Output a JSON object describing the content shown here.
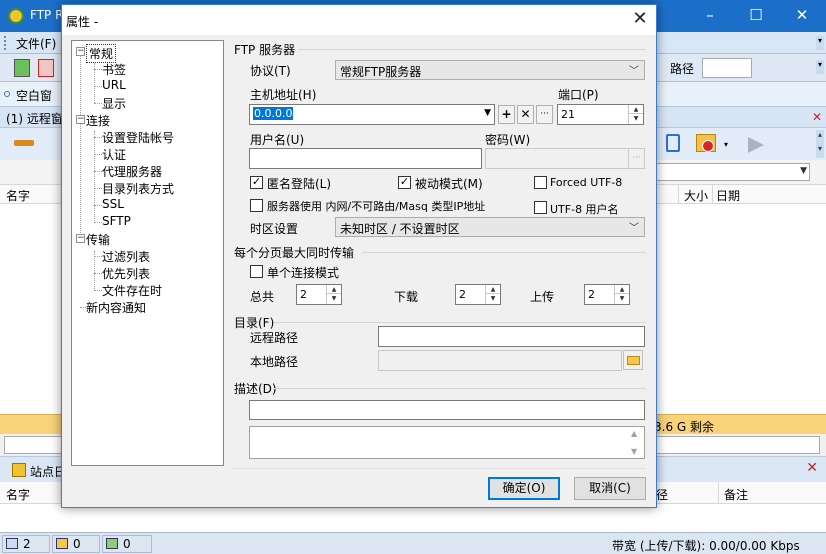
{
  "background": {
    "app_title": "FTP R",
    "menu": {
      "file": "文件(F)"
    },
    "toolbar": {
      "path_label": "路径"
    },
    "site_bar": {
      "label": "空白窗"
    },
    "remote_header": "(1) 远程窗",
    "columns": {
      "name": "名字",
      "size": "大小",
      "date": "日期"
    },
    "free_space": "3.6 G 剩余",
    "site_tab": "站点日",
    "bottom_columns": {
      "name": "名字",
      "path": "径",
      "note": "备注"
    },
    "status": {
      "count1": "2",
      "count2": "0",
      "count3": "0",
      "bandwidth": "带宽 (上传/下载): 0.00/0.00 Kbps"
    }
  },
  "dialog": {
    "title": "属性 -",
    "close_glyph": "✕",
    "tree": {
      "general": "常规",
      "bookmarks": "书签",
      "url": "URL",
      "display": "显示",
      "connection": "连接",
      "login_accounts": "设置登陆帐号",
      "auth": "认证",
      "proxy": "代理服务器",
      "list_method": "目录列表方式",
      "ssl": "SSL",
      "sftp": "SFTP",
      "transfer": "传输",
      "filter_list": "过滤列表",
      "priority_list": "优先列表",
      "file_exists": "文件存在时",
      "new_content": "新内容通知"
    },
    "ftp_server": {
      "section": "FTP 服务器",
      "protocol_label": "协议(T)",
      "protocol_value": "常规FTP服务器",
      "host_label": "主机地址(H)",
      "host_value": "0.0.0.0",
      "port_label": "端口(P)",
      "port_value": "21",
      "user_label": "用户名(U)",
      "user_value": "",
      "password_label": "密码(W)",
      "password_value": "",
      "btn_add": "+",
      "btn_remove": "✕",
      "btn_more": "···",
      "anonymous": {
        "label": "匿名登陆(L)",
        "checked": true
      },
      "passive": {
        "label": "被动模式(M)",
        "checked": true
      },
      "forced_utf8": {
        "label": "Forced UTF-8",
        "checked": false
      },
      "lan_ip": {
        "label": "服务器使用 内网/不可路由/Masq 类型IP地址",
        "checked": false
      },
      "utf8_user": {
        "label": "UTF-8 用户名",
        "checked": false
      },
      "timezone_label": "时区设置",
      "timezone_value": "未知时区 / 不设置时区"
    },
    "transfer": {
      "section": "每个分页最大同时传输",
      "single_conn": {
        "label": "单个连接模式",
        "checked": false
      },
      "total_label": "总共",
      "total_value": "2",
      "download_label": "下载",
      "download_value": "2",
      "upload_label": "上传",
      "upload_value": "2"
    },
    "directory": {
      "section": "目录(F)",
      "remote_label": "远程路径",
      "remote_value": "",
      "local_label": "本地路径",
      "local_value": ""
    },
    "description": {
      "section": "描述(D)",
      "line_value": "",
      "area_value": ""
    },
    "ok_label": "确定(O)",
    "cancel_label": "取消(C)"
  }
}
